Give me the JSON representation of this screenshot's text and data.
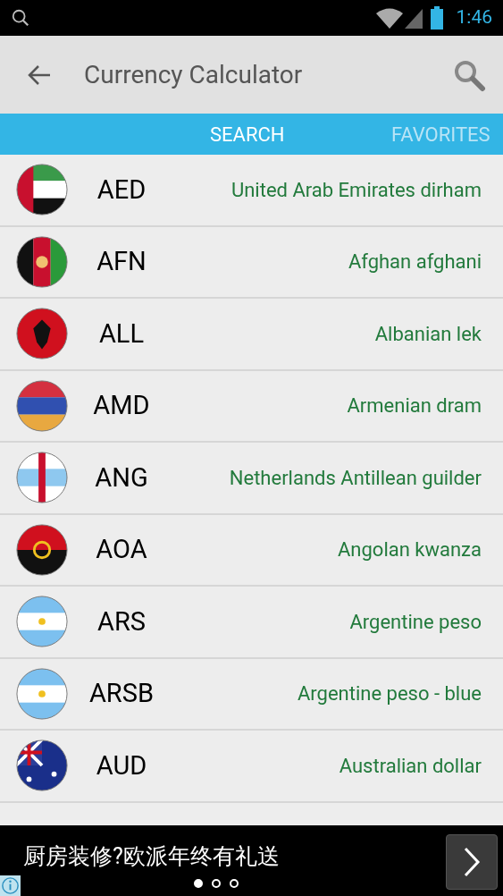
{
  "status_bar": {
    "time": "1:46"
  },
  "app_bar": {
    "title": "Currency Calculator"
  },
  "tabs": [
    {
      "label": "SEARCH",
      "selected": true
    },
    {
      "label": "FAVORITES",
      "selected": false
    }
  ],
  "currencies": [
    {
      "code": "AED",
      "name": "United Arab Emirates dirham"
    },
    {
      "code": "AFN",
      "name": "Afghan afghani"
    },
    {
      "code": "ALL",
      "name": "Albanian lek"
    },
    {
      "code": "AMD",
      "name": "Armenian dram"
    },
    {
      "code": "ANG",
      "name": "Netherlands Antillean guilder"
    },
    {
      "code": "AOA",
      "name": "Angolan kwanza"
    },
    {
      "code": "ARS",
      "name": "Argentine peso"
    },
    {
      "code": "ARSB",
      "name": "Argentine peso - blue"
    },
    {
      "code": "AUD",
      "name": "Australian dollar"
    }
  ],
  "ad_banner": {
    "text": "厨房装修?欧派年终有礼送",
    "pages": [
      {
        "selected": true
      },
      {
        "selected": false
      },
      {
        "selected": false
      }
    ]
  }
}
